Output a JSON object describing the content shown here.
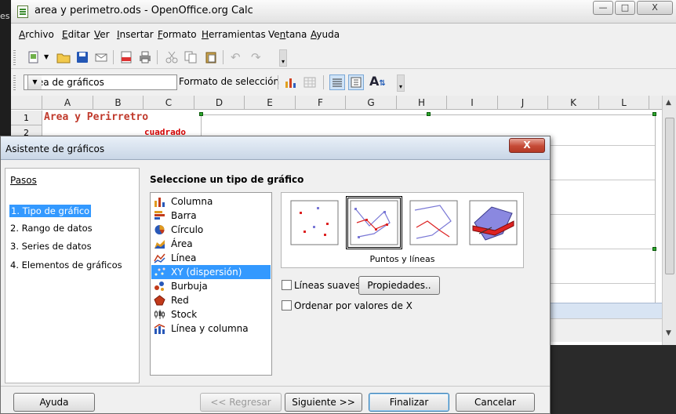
{
  "window": {
    "title": "area y perimetro.ods - OpenOffice.org Calc",
    "left_strip_text": "es",
    "min_glyph": "—",
    "max_glyph": "□",
    "close_glyph": "X"
  },
  "menu": [
    {
      "label": "Archivo",
      "accel": "A",
      "rest": "rchivo"
    },
    {
      "label": "Editar",
      "accel": "E",
      "rest": "ditar"
    },
    {
      "label": "Ver",
      "accel": "V",
      "rest": "er"
    },
    {
      "label": "Insertar",
      "accel": "I",
      "rest": "nsertar"
    },
    {
      "label": "Formato",
      "accel": "F",
      "rest": "ormato"
    },
    {
      "label": "Herramientas",
      "accel": "H",
      "rest": "erramientas"
    },
    {
      "label": "Ventana",
      "pre": "Ve",
      "accel": "n",
      "rest": "tana"
    },
    {
      "label": "Ayuda",
      "accel": "A",
      "rest": "yuda"
    }
  ],
  "toolbar2": {
    "name_box_value": "Área de gráficos",
    "format_selection_label": "Formato de selección"
  },
  "sheet": {
    "columns": [
      "A",
      "B",
      "C",
      "D",
      "E",
      "F",
      "G",
      "H",
      "I",
      "J",
      "K",
      "L"
    ],
    "rows": [
      "1",
      "2"
    ],
    "a1": "Area  y  Perirretro",
    "c2": "cuadrado"
  },
  "dialog": {
    "title": "Asistente de gráficos",
    "close_glyph": "X",
    "steps_title": "Pasos",
    "steps": [
      "1. Tipo de gráfico",
      "2. Rango de datos",
      "3. Series de datos",
      "4. Elementos de gráficos"
    ],
    "select_title": "Seleccione un tipo de gráfico",
    "chart_types": [
      "Columna",
      "Barra",
      "Círculo",
      "Área",
      "Línea",
      "XY (dispersión)",
      "Burbuja",
      "Red",
      "Stock",
      "Línea y columna"
    ],
    "selected_type": "XY (dispersión)",
    "variant_label": "Puntos y líneas",
    "smooth_lines_label": "Líneas suaves",
    "properties_button": "Propiedades..",
    "sort_by_x_label": "Ordenar por valores de X",
    "buttons": {
      "help": "Ayuda",
      "back": "<< Regresar",
      "next": "Siguiente >>",
      "finish": "Finalizar",
      "cancel": "Cancelar"
    }
  },
  "colors": {
    "selection": "#3399ff",
    "cell_a1_text": "#c0392b",
    "cell_c2_text": "#d40000",
    "close_red": "#c54a36"
  }
}
